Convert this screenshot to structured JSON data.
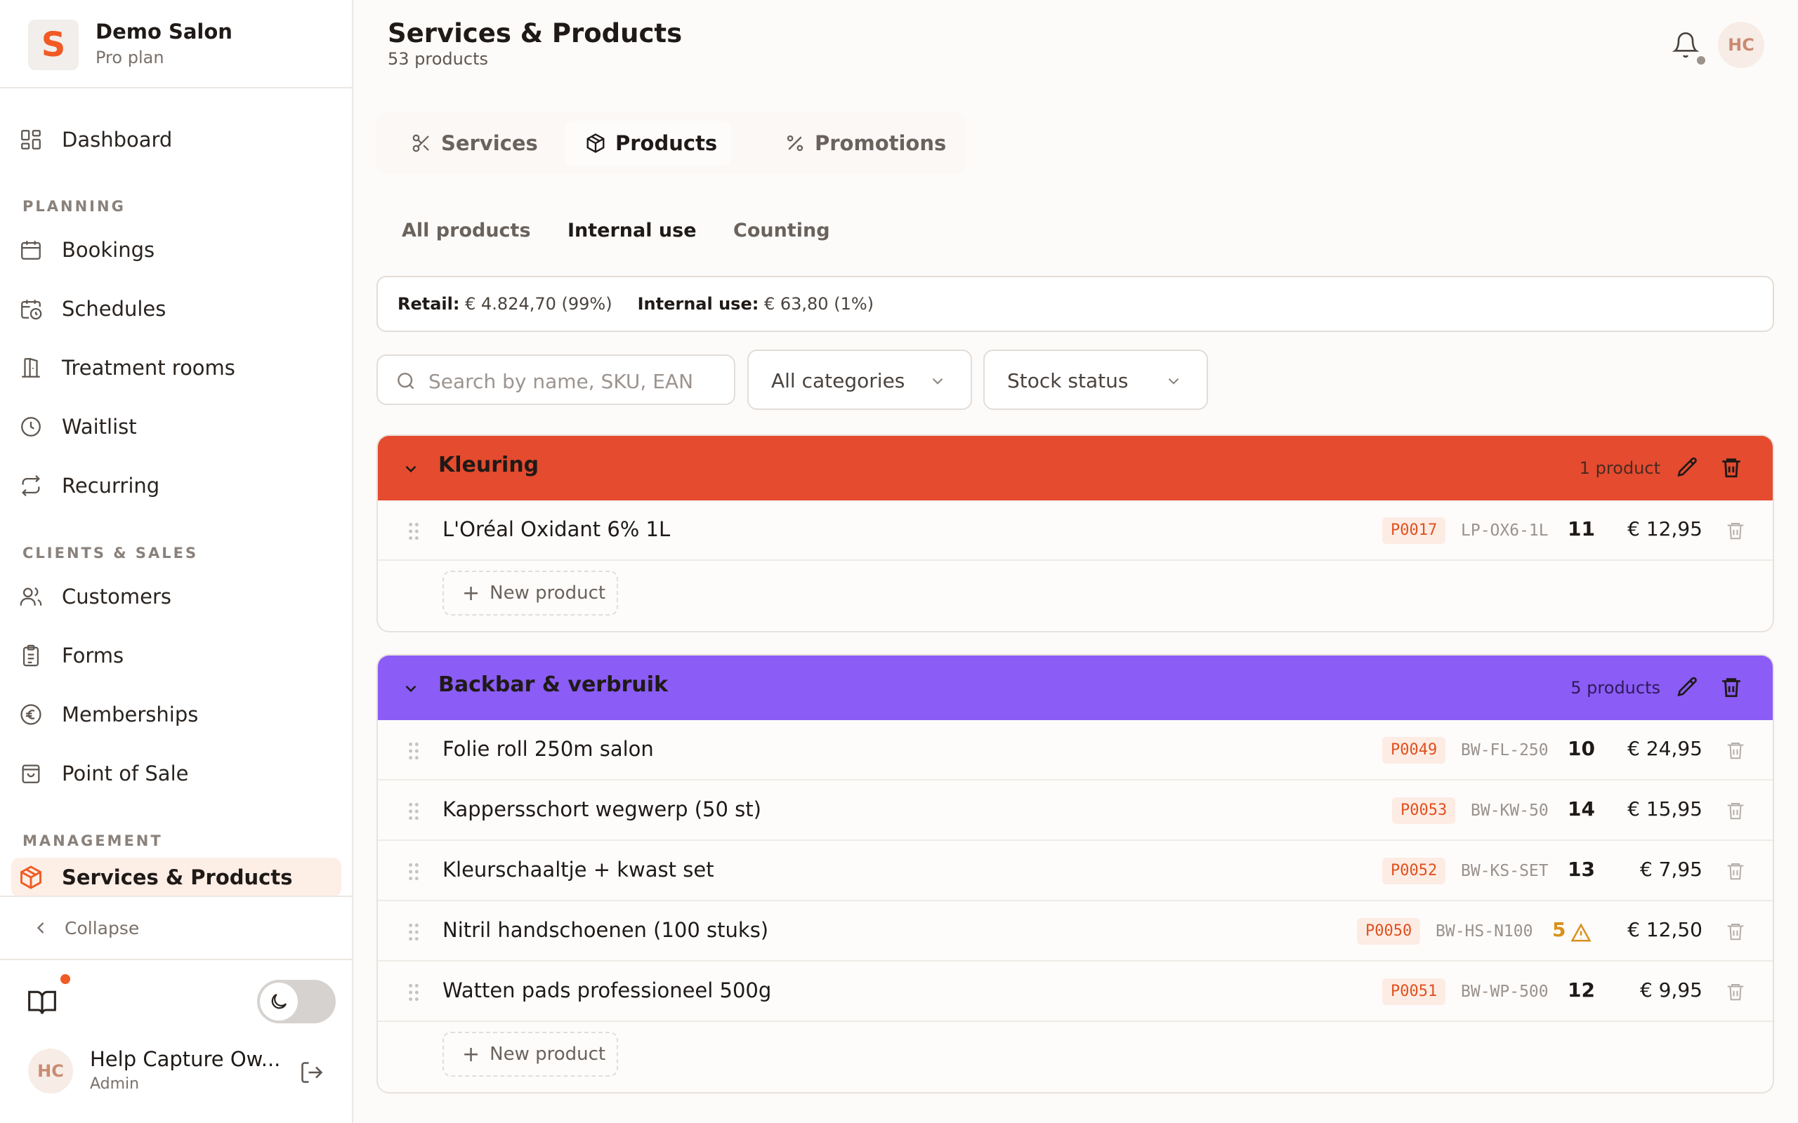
{
  "brand": {
    "name": "Demo Salon",
    "plan": "Pro plan",
    "logo_letter": "S"
  },
  "nav": {
    "dashboard": "Dashboard",
    "sections": {
      "planning": "PLANNING",
      "clients_sales": "CLIENTS & SALES",
      "management": "MANAGEMENT"
    },
    "bookings": "Bookings",
    "schedules": "Schedules",
    "treatment_rooms": "Treatment rooms",
    "waitlist": "Waitlist",
    "recurring": "Recurring",
    "customers": "Customers",
    "forms": "Forms",
    "memberships": "Memberships",
    "point_of_sale": "Point of Sale",
    "services_products": "Services & Products",
    "collapse": "Collapse"
  },
  "user": {
    "initials": "HC",
    "name": "Help Capture Ow...",
    "role": "Admin"
  },
  "header": {
    "title": "Services & Products",
    "subtitle": "53 products",
    "avatar_initials": "HC"
  },
  "tabs": {
    "services": "Services",
    "products": "Products",
    "promotions": "Promotions"
  },
  "subtabs": {
    "all": "All products",
    "internal": "Internal use",
    "counting": "Counting"
  },
  "summary": {
    "retail_label": "Retail:",
    "retail_value": "€ 4.824,70 (99%)",
    "internal_label": "Internal use:",
    "internal_value": "€ 63,80 (1%)"
  },
  "filters": {
    "search_placeholder": "Search by name, SKU, EAN",
    "category": "All categories",
    "stock": "Stock status"
  },
  "groups": [
    {
      "name": "Kleuring",
      "count": "1 product",
      "color": "#e54b2f",
      "new_label": "New product",
      "products": [
        {
          "name": "L'Oréal Oxidant 6% 1L",
          "code": "P0017",
          "sku": "LP-OX6-1L",
          "qty": "11",
          "price": "€ 12,95"
        }
      ]
    },
    {
      "name": "Backbar & verbruik",
      "count": "5 products",
      "color": "#8b5cf6",
      "new_label": "New product",
      "products": [
        {
          "name": "Folie roll 250m salon",
          "code": "P0049",
          "sku": "BW-FL-250",
          "qty": "10",
          "price": "€ 24,95"
        },
        {
          "name": "Kappersschort wegwerp (50 st)",
          "code": "P0053",
          "sku": "BW-KW-50",
          "qty": "14",
          "price": "€ 15,95"
        },
        {
          "name": "Kleurschaaltje + kwast set",
          "code": "P0052",
          "sku": "BW-KS-SET",
          "qty": "13",
          "price": "€ 7,95"
        },
        {
          "name": "Nitril handschoenen (100 stuks)",
          "code": "P0050",
          "sku": "BW-HS-N100",
          "qty": "5",
          "price": "€ 12,50",
          "low_stock": true
        },
        {
          "name": "Watten pads professioneel 500g",
          "code": "P0051",
          "sku": "BW-WP-500",
          "qty": "12",
          "price": "€ 9,95"
        }
      ]
    }
  ]
}
